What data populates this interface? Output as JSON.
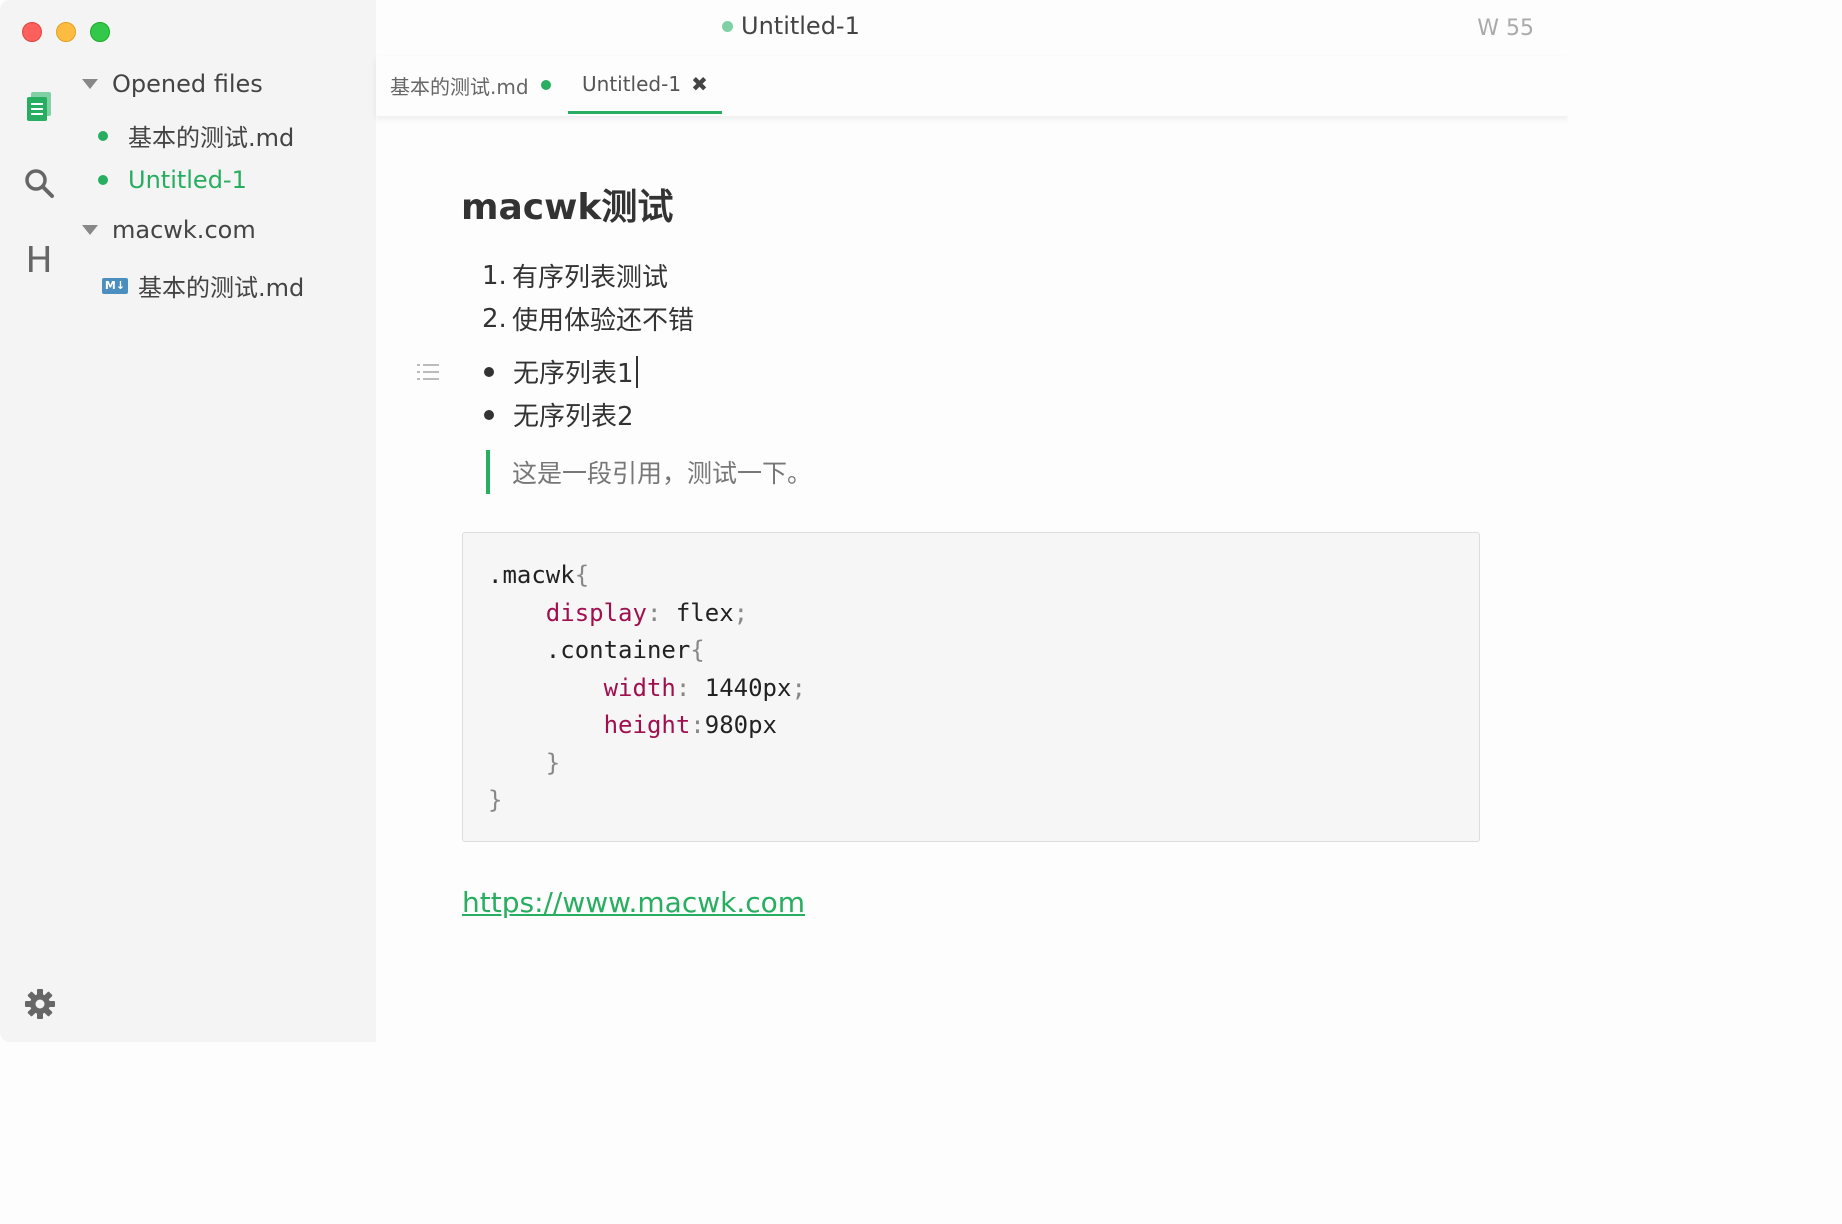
{
  "window": {
    "title": "Untitled-1",
    "word_count": "W 55"
  },
  "sidebar": {
    "rail": {
      "files_icon": "files-icon",
      "search_icon": "search-icon",
      "outline_label": "H",
      "settings_icon": "gear-icon"
    },
    "sections": [
      {
        "label": "Opened files",
        "items": [
          {
            "label": "基本的测试.md",
            "modified": true
          },
          {
            "label": "Untitled-1",
            "modified": true,
            "active": true
          }
        ]
      },
      {
        "label": "macwk.com",
        "items": [
          {
            "label": "基本的测试.md",
            "badge": "M↓"
          }
        ]
      }
    ]
  },
  "tabs": [
    {
      "label": "基本的测试.md",
      "modified": true
    },
    {
      "label": "Untitled-1",
      "active": true,
      "close": "✖"
    }
  ],
  "document": {
    "heading": "macwk测试",
    "ordered_list": [
      {
        "marker": "1.",
        "text": "有序列表测试"
      },
      {
        "marker": "2.",
        "text": "使用体验还不错"
      }
    ],
    "unordered_list": [
      "无序列表1",
      "无序列表2"
    ],
    "blockquote": "这是一段引用，测试一下。",
    "code_block": {
      "l1_sel": ".macwk",
      "l1_brace": "{",
      "l2_prop": "display",
      "l2_colon": ":",
      "l2_val": " flex",
      "l2_semi": ";",
      "l3_sel": ".container",
      "l3_brace": "{",
      "l4_prop": "width",
      "l4_colon": ":",
      "l4_val": " 1440px",
      "l4_semi": ";",
      "l5_prop": "height",
      "l5_colon": ":",
      "l5_val": "980px",
      "l6_brace": "}",
      "l7_brace": "}"
    },
    "link": "https://www.macwk.com"
  },
  "colors": {
    "accent": "#27ae60",
    "keyword": "#a0104f"
  }
}
